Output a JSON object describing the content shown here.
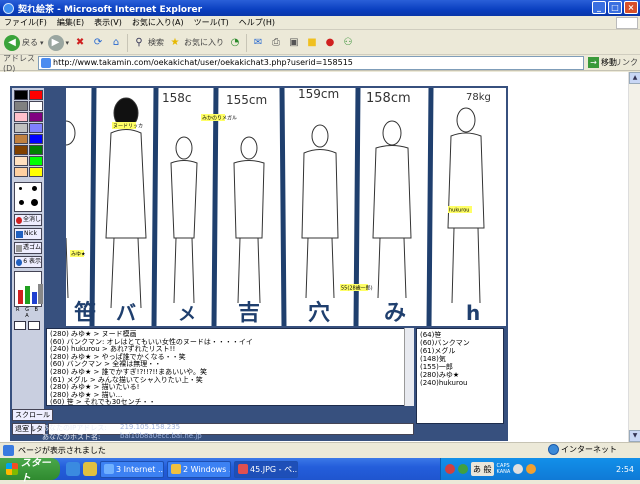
{
  "window": {
    "title": "契れ絵茶 - Microsoft Internet Explorer"
  },
  "menu": [
    "ファイル(F)",
    "編集(E)",
    "表示(V)",
    "お気に入り(A)",
    "ツール(T)",
    "ヘルプ(H)"
  ],
  "toolbar": {
    "back_label": "戻る",
    "search_label": "検索",
    "favorites_label": "お気に入り"
  },
  "address": {
    "label": "アドレス(D)",
    "url": "http://www.takamin.com/oekakichat/user/oekakichat3.php?userid=158515",
    "go_label": "移動",
    "links_label": "リンク"
  },
  "oekaki": {
    "palette_colors": [
      "#000000",
      "#ff0000",
      "#808080",
      "#ffffff",
      "#ffc0cb",
      "#800080",
      "#c0c0c0",
      "#8080ff",
      "#c08040",
      "#0000ff",
      "#804000",
      "#008000",
      "#ffe0c0",
      "#00ff00",
      "#ffd0a0",
      "#ffff00"
    ],
    "tool_buttons": [
      "全消し",
      "Nick",
      "透ゴム",
      "6 表示"
    ],
    "rgb_label": "R G B A",
    "canvas_labels": {
      "h1": "158c",
      "h2": "155cm",
      "h3": "159cm",
      "h4": "158cm",
      "h5": "78kg",
      "tag1": "ヌードリッカ",
      "tag2": "みかのりメガル",
      "tag3": "hukurou",
      "tag4": "みゆ★",
      "tag5": "55(28歳一郎)"
    },
    "chat_lines": [
      "(280) みゆ★ > ヌード模画",
      "(60) バンクマン: オレはとてもいい女性のヌードは・・・・イイ",
      "(240) hukurou > あれ?ずれたリスト!!",
      "(280) みゆ★ > やっぱ誰でかくなる・・笑",
      "(60) バンクマン > 全裸は無理・・",
      "(280) みゆ★ > 誰でかすぎ!?!!?!!まあいいや。笑",
      "(61) メグル > みんな描いてシャ入りたい上・笑",
      "(280) みゆ★ > 描いたいる!",
      "(280) みゆ★ > 描い...",
      "(60) 笹 > それでも30センチ・・",
      "(61) グル乙 全員全体もだな汗",
      "(280) みゆ★ > こう...できるの...ミルだ..."
    ],
    "users": [
      "(64)笹",
      "(60)バンクマン",
      "(61)メグル",
      "(148)気",
      "(155)一郎",
      "(280)みゆ★",
      "(240)hukurou"
    ],
    "chat_buttons": [
      "スクロール",
      "フィルタ",
      "退室"
    ],
    "ip_label": "あなたのIPアドレス:",
    "ip_value": "219.105.158.235",
    "host_label": "あなたのホスト名:",
    "host_value": "bai10b8a0ecc.bai.ne.jp"
  },
  "status": {
    "message": "ページが表示されました",
    "zone": "インターネット"
  },
  "taskbar": {
    "start": "スタート",
    "tasks": [
      {
        "label": "3 Internet ...",
        "active": false
      },
      {
        "label": "2 Windows ...",
        "active": false
      },
      {
        "label": "45.JPG - ペ...",
        "active": true
      }
    ],
    "ime": "あ 般",
    "caps": [
      "CAPS",
      "KANA"
    ],
    "clock": "2:54"
  },
  "colors": {
    "canvas_frame": "#37507e",
    "stroke_blue": "#1f3f6e",
    "title_blue": "#0a3fc0"
  }
}
